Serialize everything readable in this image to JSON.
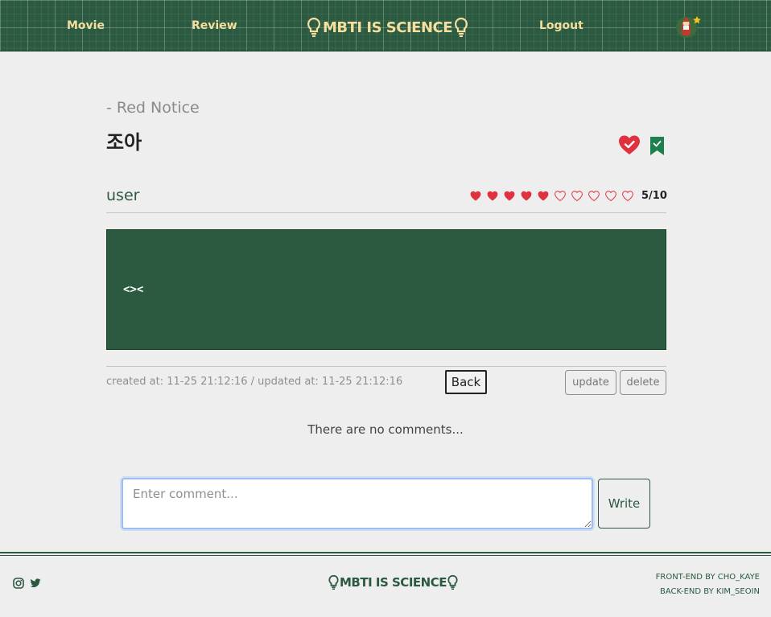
{
  "nav": {
    "movie": "Movie",
    "review": "Review",
    "brand": "MBTI IS SCIENCE",
    "logout": "Logout"
  },
  "review": {
    "movie_subtitle": "- Red Notice",
    "title": "조아",
    "author": "user",
    "rating": 5,
    "rating_max": 10,
    "rating_label": "5/10",
    "content": "<><",
    "timestamps": "created at: 11-25 21:12:16 / updated at: 11-25 21:12:16",
    "liked": true,
    "bookmarked": true
  },
  "buttons": {
    "back": "Back",
    "update": "update",
    "delete": "delete",
    "write": "Write"
  },
  "comments": {
    "empty_message": "There are no comments...",
    "placeholder": "Enter comment..."
  },
  "footer": {
    "brand": "MBTI IS SCIENCE",
    "credit_front": "FRONT-END BY CHO_KAYE",
    "credit_back": "BACK-END BY KIM_SEOIN",
    "social": [
      "instagram-icon",
      "twitter-icon"
    ]
  },
  "colors": {
    "brand_green": "#2b5a40",
    "nav_text": "#f4df9e",
    "heart_red": "#e0313f",
    "bookmark_green": "#1e7f4f",
    "background": "#eeeeee"
  }
}
